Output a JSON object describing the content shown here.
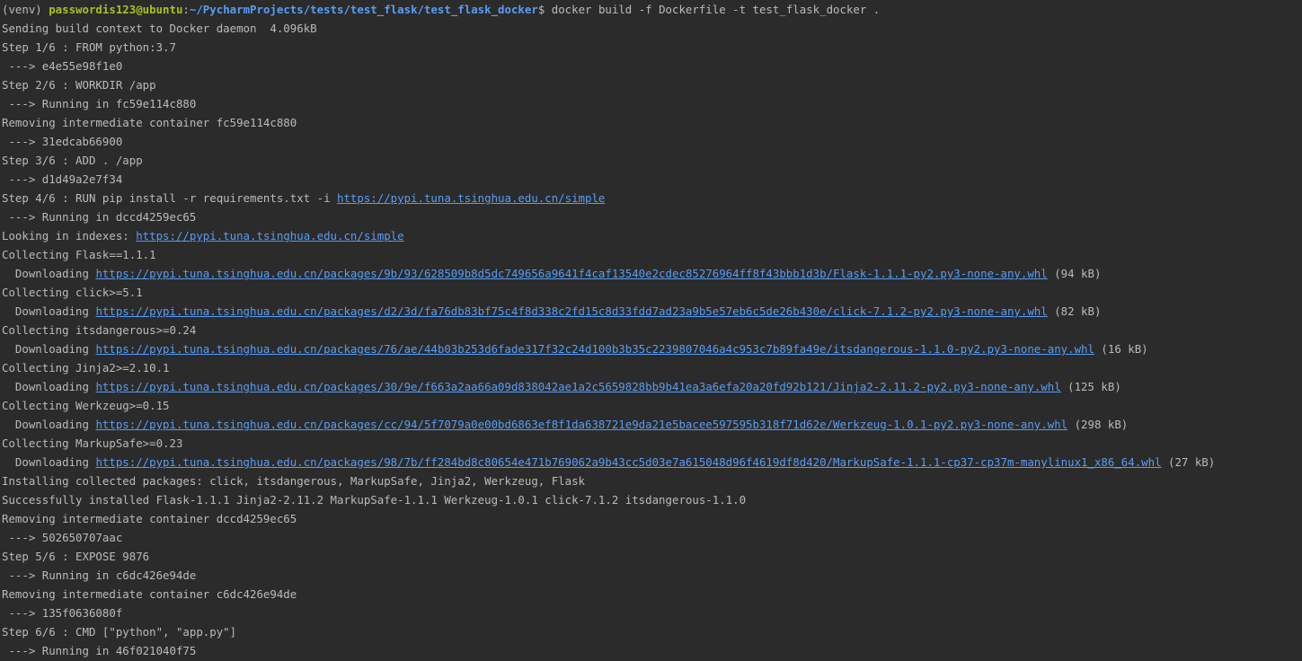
{
  "colors": {
    "background": "#2b2b2b",
    "text": "#bbbbbb",
    "prompt_user": "#a8c023",
    "prompt_path": "#589df6",
    "link": "#589df6"
  },
  "prompt": {
    "venv": "(venv) ",
    "user_host": "passwordis123@ubuntu",
    "separator": ":",
    "path": "~/PycharmProjects/tests/test_flask/test_flask_docker",
    "command": "$ docker build -f Dockerfile -t test_flask_docker ."
  },
  "lines": [
    {
      "text": "Sending build context to Docker daemon  4.096kB"
    },
    {
      "text": "Step 1/6 : FROM python:3.7"
    },
    {
      "text": " ---> e4e55e98f1e0"
    },
    {
      "text": "Step 2/6 : WORKDIR /app"
    },
    {
      "text": " ---> Running in fc59e114c880"
    },
    {
      "text": "Removing intermediate container fc59e114c880"
    },
    {
      "text": " ---> 31edcab66900"
    },
    {
      "text": "Step 3/6 : ADD . /app"
    },
    {
      "text": " ---> d1d49a2e7f34"
    },
    {
      "text": "Step 4/6 : RUN pip install -r requirements.txt -i ",
      "link": "https://pypi.tuna.tsinghua.edu.cn/simple"
    },
    {
      "text": " ---> Running in dccd4259ec65"
    },
    {
      "text": "Looking in indexes: ",
      "link": "https://pypi.tuna.tsinghua.edu.cn/simple"
    },
    {
      "text": "Collecting Flask==1.1.1"
    },
    {
      "text": "  Downloading ",
      "link": "https://pypi.tuna.tsinghua.edu.cn/packages/9b/93/628509b8d5dc749656a9641f4caf13540e2cdec85276964ff8f43bbb1d3b/Flask-1.1.1-py2.py3-none-any.whl",
      "after": " (94 kB)"
    },
    {
      "text": "Collecting click>=5.1"
    },
    {
      "text": "  Downloading ",
      "link": "https://pypi.tuna.tsinghua.edu.cn/packages/d2/3d/fa76db83bf75c4f8d338c2fd15c8d33fdd7ad23a9b5e57eb6c5de26b430e/click-7.1.2-py2.py3-none-any.whl",
      "after": " (82 kB)"
    },
    {
      "text": "Collecting itsdangerous>=0.24"
    },
    {
      "text": "  Downloading ",
      "link": "https://pypi.tuna.tsinghua.edu.cn/packages/76/ae/44b03b253d6fade317f32c24d100b3b35c2239807046a4c953c7b89fa49e/itsdangerous-1.1.0-py2.py3-none-any.whl",
      "after": " (16 kB)"
    },
    {
      "text": "Collecting Jinja2>=2.10.1"
    },
    {
      "text": "  Downloading ",
      "link": "https://pypi.tuna.tsinghua.edu.cn/packages/30/9e/f663a2aa66a09d838042ae1a2c5659828bb9b41ea3a6efa20a20fd92b121/Jinja2-2.11.2-py2.py3-none-any.whl",
      "after": " (125 kB)"
    },
    {
      "text": "Collecting Werkzeug>=0.15"
    },
    {
      "text": "  Downloading ",
      "link": "https://pypi.tuna.tsinghua.edu.cn/packages/cc/94/5f7079a0e00bd6863ef8f1da638721e9da21e5bacee597595b318f71d62e/Werkzeug-1.0.1-py2.py3-none-any.whl",
      "after": " (298 kB)"
    },
    {
      "text": "Collecting MarkupSafe>=0.23"
    },
    {
      "text": "  Downloading ",
      "link": "https://pypi.tuna.tsinghua.edu.cn/packages/98/7b/ff284bd8c80654e471b769062a9b43cc5d03e7a615048d96f4619df8d420/MarkupSafe-1.1.1-cp37-cp37m-manylinux1_x86_64.whl",
      "after": " (27 kB)"
    },
    {
      "text": "Installing collected packages: click, itsdangerous, MarkupSafe, Jinja2, Werkzeug, Flask"
    },
    {
      "text": "Successfully installed Flask-1.1.1 Jinja2-2.11.2 MarkupSafe-1.1.1 Werkzeug-1.0.1 click-7.1.2 itsdangerous-1.1.0"
    },
    {
      "text": "Removing intermediate container dccd4259ec65"
    },
    {
      "text": " ---> 502650707aac"
    },
    {
      "text": "Step 5/6 : EXPOSE 9876"
    },
    {
      "text": " ---> Running in c6dc426e94de"
    },
    {
      "text": "Removing intermediate container c6dc426e94de"
    },
    {
      "text": " ---> 135f0636080f"
    },
    {
      "text": "Step 6/6 : CMD [\"python\", \"app.py\"]"
    },
    {
      "text": " ---> Running in 46f021040f75"
    }
  ]
}
